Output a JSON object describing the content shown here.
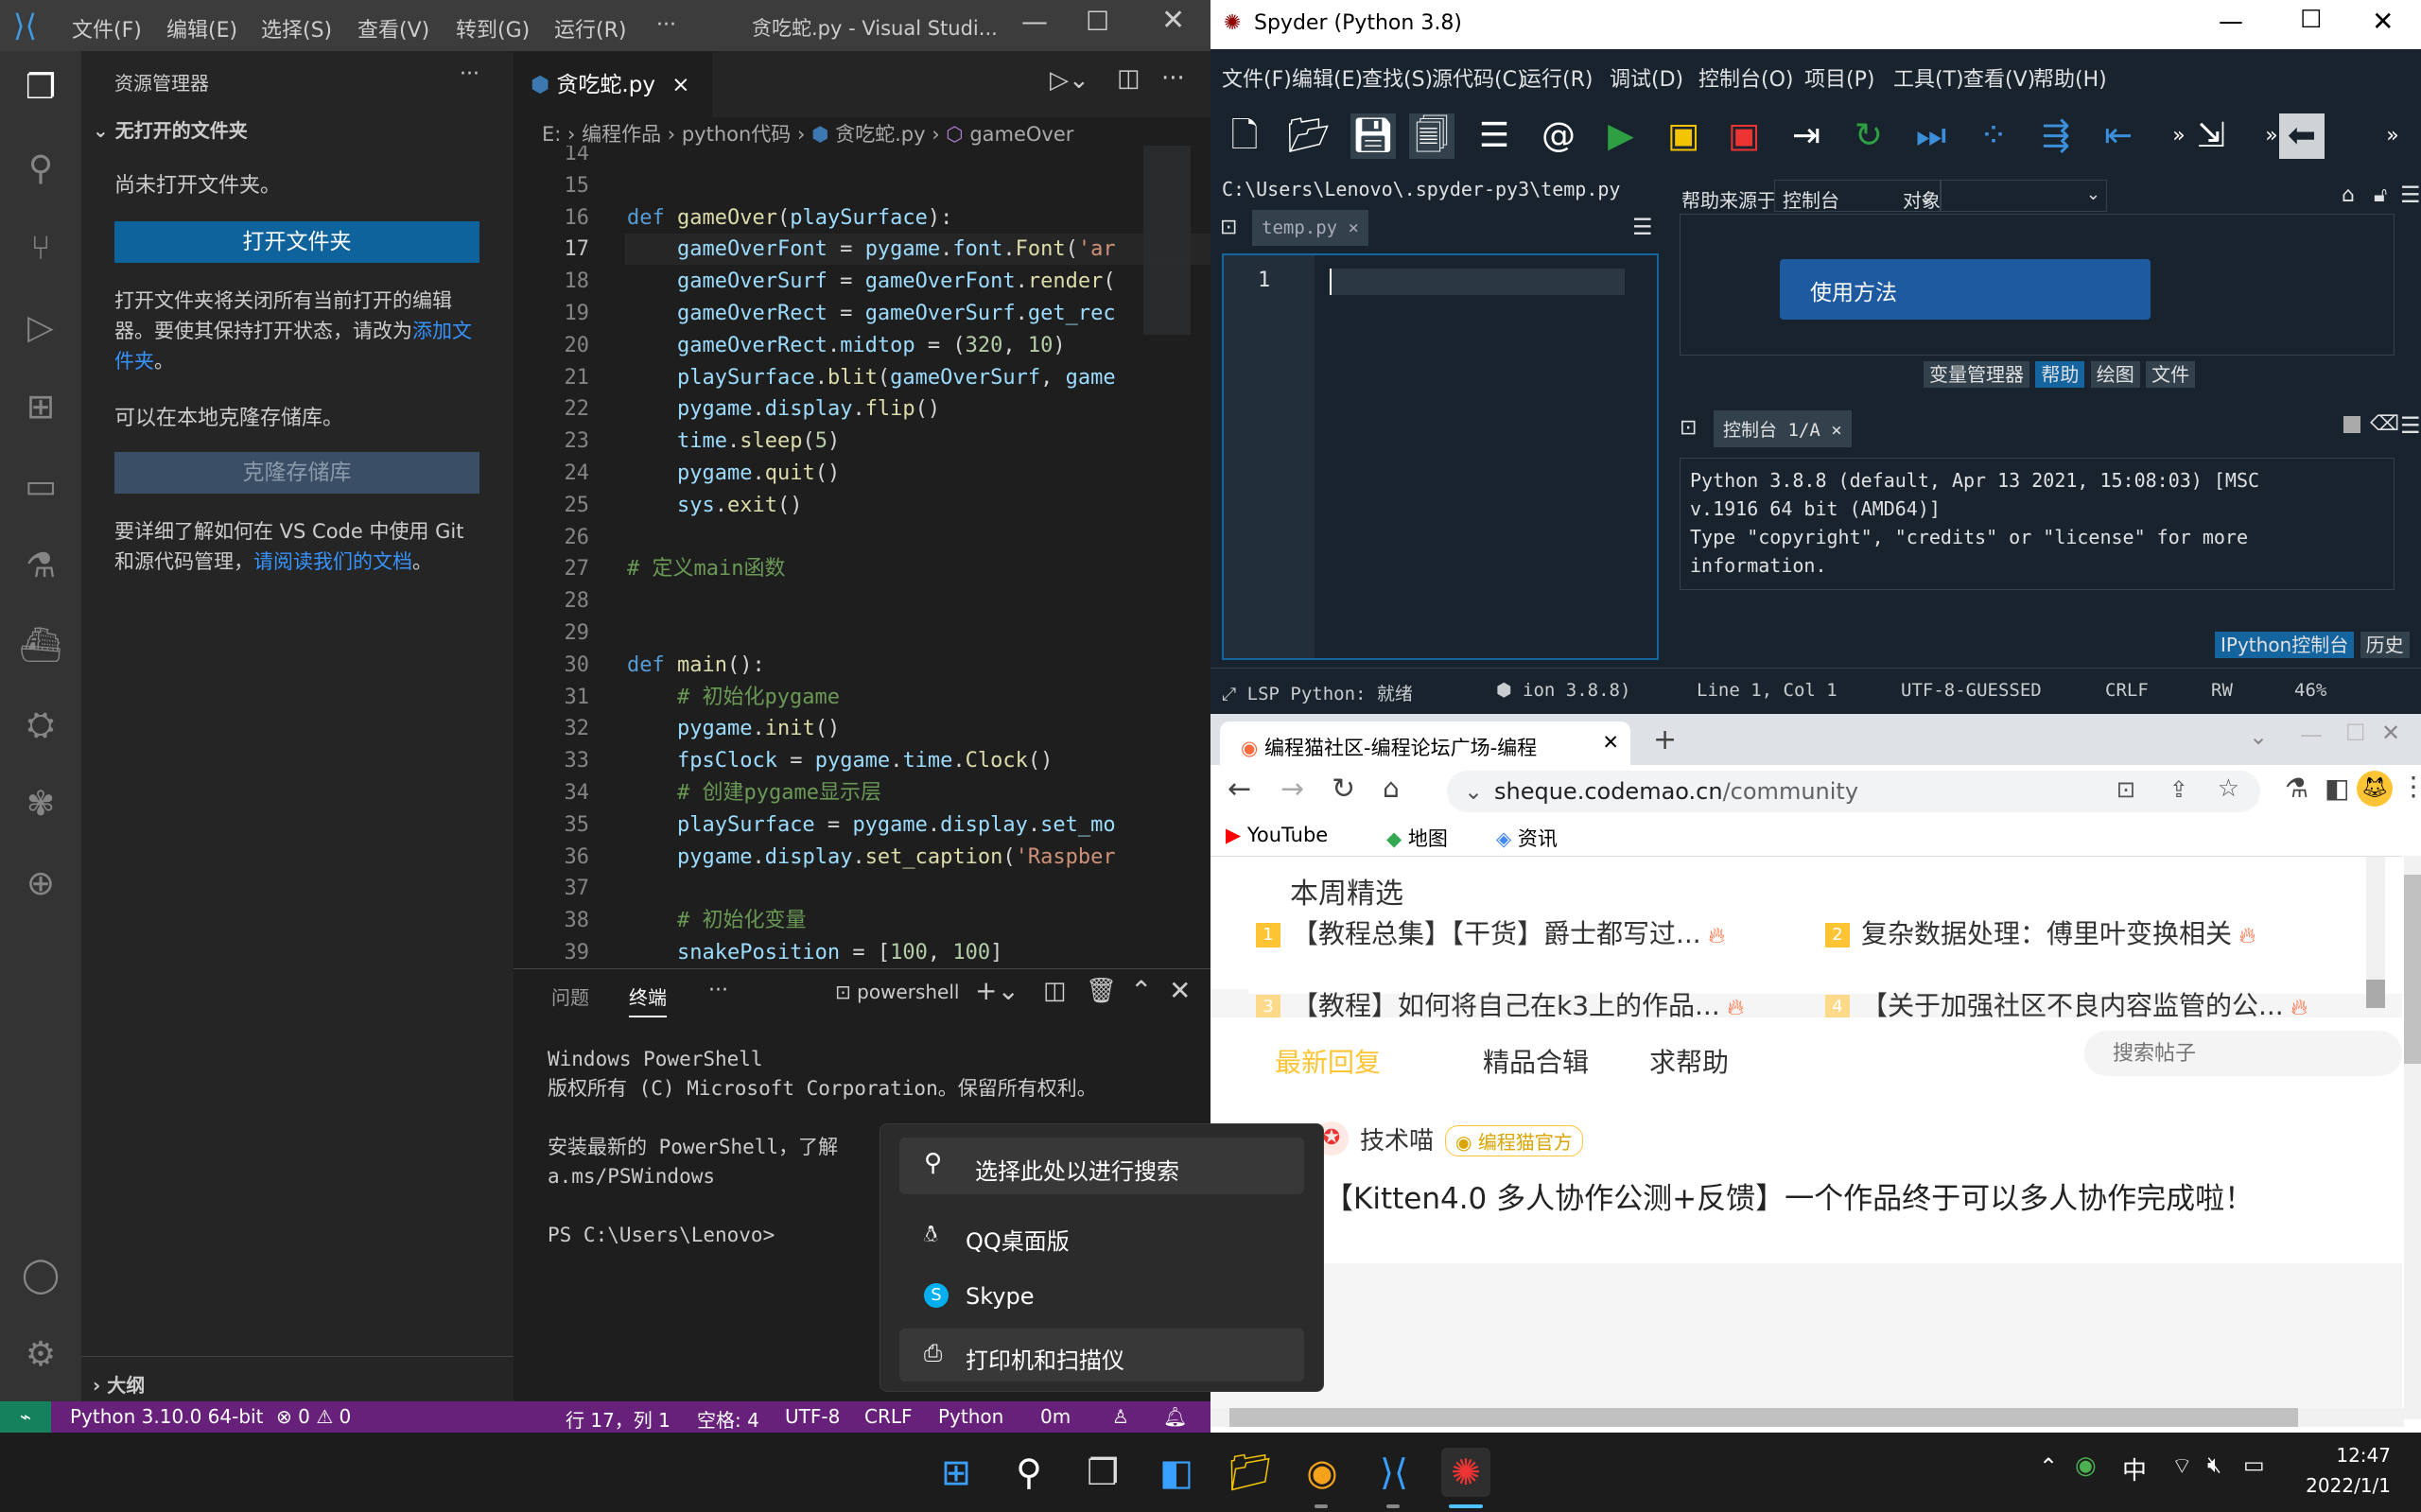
{
  "vscode": {
    "window_title": "贪吃蛇.py - Visual Studi...",
    "menu": [
      "文件(F)",
      "编辑(E)",
      "选择(S)",
      "查看(V)",
      "转到(G)",
      "运行(R)",
      "···"
    ],
    "explorer": {
      "header": "资源管理器",
      "more": "···",
      "section": "无打开的文件夹",
      "no_folder": "尚未打开文件夹。",
      "open_folder_btn": "打开文件夹",
      "desc1": "打开文件夹将关闭所有当前打开的编辑器。要使其保持打开状态，请改为",
      "add_folder_link": "添加文件夹",
      "desc1_end": "。",
      "clone_desc": "可以在本地克隆存储库。",
      "clone_btn": "克隆存储库",
      "git_desc": "要详细了解如何在 VS Code 中使用 Git 和源代码管理，",
      "git_link": "请阅读我们的文档",
      "git_end": "。",
      "outline": "大纲"
    },
    "tab": {
      "name": "贪吃蛇.py",
      "close": "×"
    },
    "breadcrumb": {
      "drive": "E:",
      "p1": "编程作品",
      "p2": "python代码",
      "file": "贪吃蛇.py",
      "func": "gameOver"
    },
    "code_lines": [
      {
        "n": "14",
        "t": ""
      },
      {
        "n": "15",
        "t": ""
      },
      {
        "n": "16",
        "t": "def gameOver(playSurface):"
      },
      {
        "n": "17",
        "t": "    gameOverFont = pygame.font.Font('ar"
      },
      {
        "n": "18",
        "t": "    gameOverSurf = gameOverFont.render("
      },
      {
        "n": "19",
        "t": "    gameOverRect = gameOverSurf.get_rec"
      },
      {
        "n": "20",
        "t": "    gameOverRect.midtop = (320, 10)"
      },
      {
        "n": "21",
        "t": "    playSurface.blit(gameOverSurf, game"
      },
      {
        "n": "22",
        "t": "    pygame.display.flip()"
      },
      {
        "n": "23",
        "t": "    time.sleep(5)"
      },
      {
        "n": "24",
        "t": "    pygame.quit()"
      },
      {
        "n": "25",
        "t": "    sys.exit()"
      },
      {
        "n": "26",
        "t": ""
      },
      {
        "n": "27",
        "t": "# 定义main函数"
      },
      {
        "n": "28",
        "t": ""
      },
      {
        "n": "29",
        "t": ""
      },
      {
        "n": "30",
        "t": "def main():"
      },
      {
        "n": "31",
        "t": "    # 初始化pygame"
      },
      {
        "n": "32",
        "t": "    pygame.init()"
      },
      {
        "n": "33",
        "t": "    fpsClock = pygame.time.Clock()"
      },
      {
        "n": "34",
        "t": "    # 创建pygame显示层"
      },
      {
        "n": "35",
        "t": "    playSurface = pygame.display.set_mo"
      },
      {
        "n": "36",
        "t": "    pygame.display.set_caption('Raspber"
      },
      {
        "n": "37",
        "t": ""
      },
      {
        "n": "38",
        "t": "    # 初始化变量"
      },
      {
        "n": "39",
        "t": "    snakePosition = [100, 100]"
      }
    ],
    "panel": {
      "tabs": [
        "问题",
        "终端",
        "···"
      ],
      "shell": "powershell",
      "lines": [
        "Windows PowerShell",
        "版权所有 (C) Microsoft Corporation。保留所有权利。",
        "",
        "安装最新的 PowerShell，了解",
        "a.ms/PSWindows",
        "",
        "PS C:\\Users\\Lenovo>"
      ]
    },
    "status": {
      "python": "Python 3.10.0 64-bit",
      "problems": "⊗ 0 ⚠ 0",
      "pos": "行 17，列 1",
      "spaces": "空格: 4",
      "enc": "UTF-8",
      "eol": "CRLF",
      "lang": "Python",
      "extra": "0m"
    }
  },
  "spyder": {
    "title": "Spyder (Python 3.8)",
    "menu": [
      "文件(F)",
      "编辑(E)",
      "查找(S)",
      "源代码(C)",
      "运行(R)",
      "调试(D)",
      "控制台(O)",
      "项目(P)",
      "工具(T)",
      "查看(V)",
      "帮助(H)"
    ],
    "path": "C:\\Users\\Lenovo\\.spyder-py3\\temp.py",
    "file_tab": "temp.py",
    "line_num": "1",
    "help": {
      "source_label": "帮助来源于",
      "source_value": "控制台",
      "object_label": "对象",
      "usage": "使用方法",
      "tabs": [
        "变量管理器",
        "帮助",
        "绘图",
        "文件"
      ]
    },
    "console": {
      "tab": "控制台 1/A",
      "lines": [
        "Python 3.8.8 (default, Apr 13 2021, 15:08:03) [MSC",
        "v.1916 64 bit (AMD64)]",
        "Type \"copyright\", \"credits\" or \"license\" for more",
        "information."
      ],
      "bottom_tabs": [
        "IPython控制台",
        "历史"
      ]
    },
    "status": {
      "lsp": "LSP Python: 就绪",
      "py": "ion 3.8.8)",
      "line": "Line 1, Col 1",
      "enc": "UTF-8-GUESSED",
      "eol": "CRLF",
      "rw": "RW",
      "mem": "46%"
    }
  },
  "browser": {
    "tab_title": "编程猫社区-编程论坛广场-编程",
    "url_host": "sheque.codemao.cn",
    "url_path": "/community",
    "bookmarks": [
      "YouTube",
      "地图",
      "资讯"
    ],
    "weekly": "本周精选",
    "items": [
      {
        "num": "1",
        "text": "【教程总集】【干货】爵士都写过..."
      },
      {
        "num": "2",
        "text": "复杂数据处理：傅里叶变换相关"
      },
      {
        "num": "3",
        "text": "【教程】如何将自己在k3上的作品..."
      },
      {
        "num": "4",
        "text": "【关于加强社区不良内容监管的公..."
      }
    ],
    "tabs": [
      "最新回复",
      "精品合辑",
      "求帮助"
    ],
    "search_placeholder": "搜索帖子",
    "author": "技术喵",
    "badge": "编程猫官方",
    "post_title": "【Kitten4.0 多人协作公测+反馈】一个作品终于可以多人协作完成啦！"
  },
  "popup": {
    "search": "选择此处以进行搜索",
    "items": [
      "QQ桌面版",
      "Skype",
      "打印机和扫描仪"
    ]
  },
  "taskbar": {
    "time": "12:47",
    "date": "2022/1/1",
    "ime": "中"
  },
  "colors": {
    "vscode_status": "#68217a",
    "spyder_bg": "#19232d",
    "accent_blue": "#0e639c",
    "codemao_orange": "#fec433"
  }
}
